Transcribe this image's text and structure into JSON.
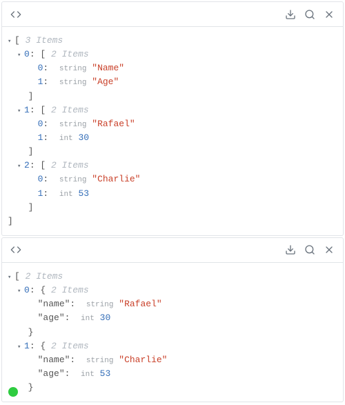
{
  "icons": {
    "code": "code-icon",
    "download": "download-icon",
    "search": "search-icon",
    "close": "close-icon"
  },
  "labels": {
    "items_3": "3 Items",
    "items_2": "2 Items",
    "type_string": "string",
    "type_int": "int"
  },
  "panel1": {
    "root_count": "3 Items",
    "rows": [
      {
        "idx": "0",
        "count": "2 Items",
        "children": [
          {
            "idx": "0",
            "type": "string",
            "value": "\"Name\""
          },
          {
            "idx": "1",
            "type": "string",
            "value": "\"Age\""
          }
        ]
      },
      {
        "idx": "1",
        "count": "2 Items",
        "children": [
          {
            "idx": "0",
            "type": "string",
            "value": "\"Rafael\""
          },
          {
            "idx": "1",
            "type": "int",
            "value": "30"
          }
        ]
      },
      {
        "idx": "2",
        "count": "2 Items",
        "children": [
          {
            "idx": "0",
            "type": "string",
            "value": "\"Charlie\""
          },
          {
            "idx": "1",
            "type": "int",
            "value": "53"
          }
        ]
      }
    ]
  },
  "panel2": {
    "root_count": "2 Items",
    "rows": [
      {
        "idx": "0",
        "count": "2 Items",
        "children": [
          {
            "key": "\"name\"",
            "type": "string",
            "value": "\"Rafael\""
          },
          {
            "key": "\"age\"",
            "type": "int",
            "value": "30"
          }
        ]
      },
      {
        "idx": "1",
        "count": "2 Items",
        "children": [
          {
            "key": "\"name\"",
            "type": "string",
            "value": "\"Charlie\""
          },
          {
            "key": "\"age\"",
            "type": "int",
            "value": "53"
          }
        ]
      }
    ]
  }
}
